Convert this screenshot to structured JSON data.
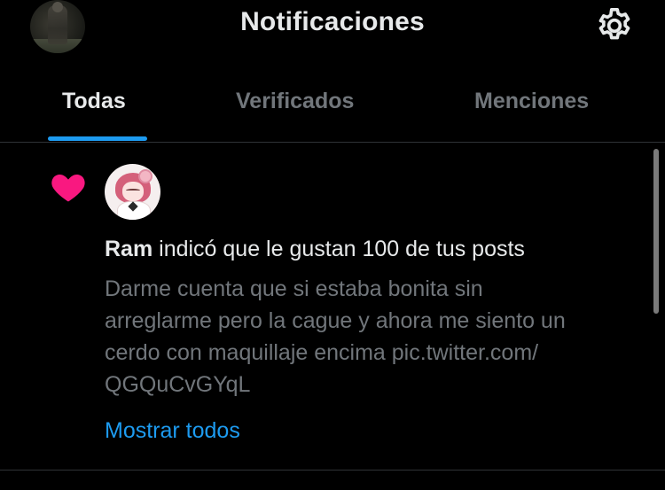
{
  "header": {
    "title": "Notificaciones",
    "avatar_icon": "profile-avatar",
    "settings_icon": "gear-icon"
  },
  "tabs": [
    {
      "label": "Todas",
      "active": true
    },
    {
      "label": "Verificados",
      "active": false
    },
    {
      "label": "Menciones",
      "active": false
    }
  ],
  "notification": {
    "icon": "heart-icon",
    "icon_color": "#f91880",
    "user": "Ram",
    "action_text": " indicó que le gustan 100 de tus posts",
    "post_lines": [
      "Darme cuenta que si estaba bonita sin",
      "arreglarme pero la cague y ahora me siento un",
      "cerdo con maquillaje encima pic.twitter.com/",
      "QGQuCvGYqL"
    ],
    "show_all": "Mostrar todos"
  },
  "colors": {
    "background": "#000000",
    "text_primary": "#e7e9ea",
    "text_secondary": "#71767b",
    "accent": "#1d9bf0",
    "divider": "#2f3336"
  }
}
